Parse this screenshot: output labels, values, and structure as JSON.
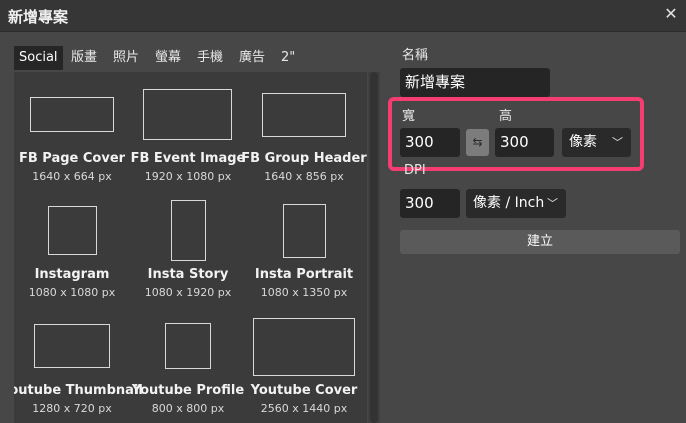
{
  "window": {
    "title": "新增專案"
  },
  "tabs": [
    "Social",
    "版畫",
    "照片",
    "螢幕",
    "手機",
    "廣告",
    "2\""
  ],
  "presets": [
    {
      "name": "FB Page Cover",
      "size": "1640 x 664 px"
    },
    {
      "name": "FB Event Image",
      "size": "1920 x 1080 px"
    },
    {
      "name": "FB Group Header",
      "size": "1640 x 856 px"
    },
    {
      "name": "Instagram",
      "size": "1080 x 1080 px"
    },
    {
      "name": "Insta Story",
      "size": "1080 x 1920 px"
    },
    {
      "name": "Insta Portrait",
      "size": "1080 x 1350 px"
    },
    {
      "name": "Youtube Thumbnail",
      "size": "1280 x 720 px"
    },
    {
      "name": "Youtube Profile",
      "size": "800 x 800 px"
    },
    {
      "name": "Youtube Cover",
      "size": "2560 x 1440 px"
    }
  ],
  "form": {
    "name_label": "名稱",
    "name_value": "新增專案",
    "width_label": "寬",
    "width_value": "300",
    "height_label": "高",
    "height_value": "300",
    "unit_value": "像素",
    "dpi_label": "DPI",
    "dpi_value": "300",
    "dpi_unit_value": "像素 / Inch",
    "create_label": "建立"
  },
  "colors": {
    "highlight": "#f53d72"
  }
}
